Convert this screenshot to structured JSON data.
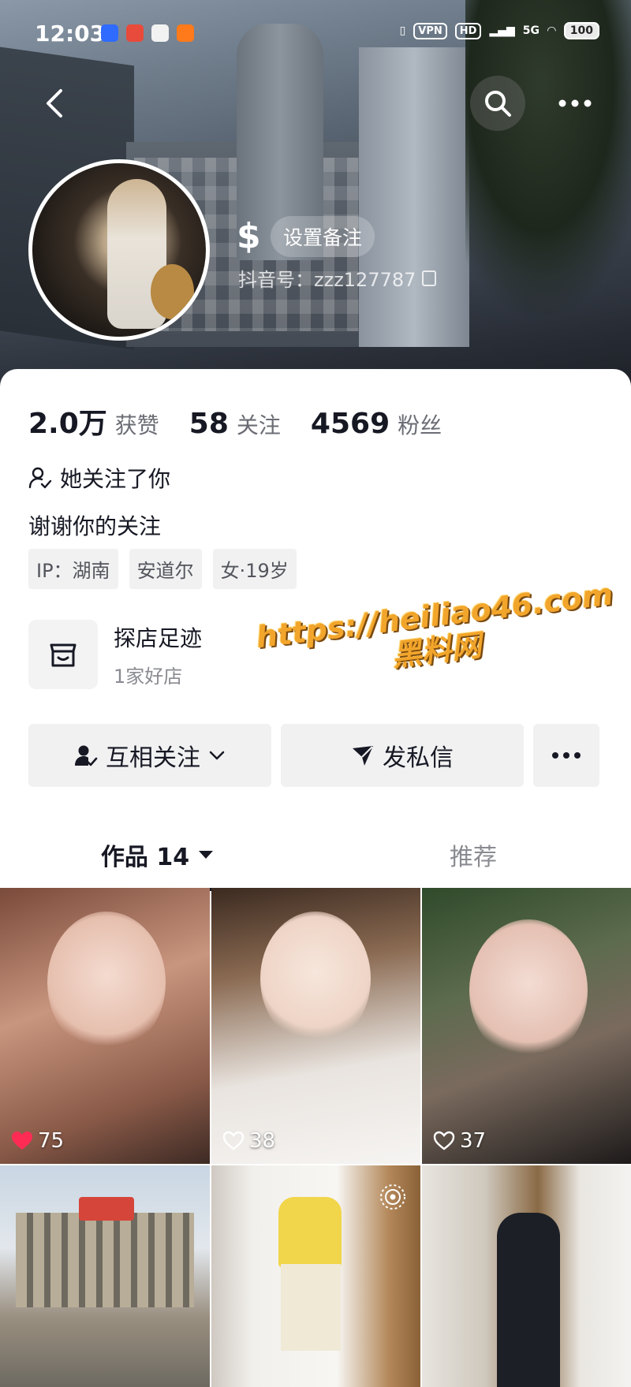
{
  "status_bar": {
    "time": "12:03",
    "vpn": "VPN",
    "hd": "HD",
    "net": "5G",
    "battery": "100"
  },
  "profile": {
    "remark_button": "设置备注",
    "id_label": "抖音号：zzz127787",
    "likes_count": "2.0万",
    "likes_label": "获赞",
    "following_count": "58",
    "following_label": "关注",
    "followers_count": "4569",
    "followers_label": "粉丝",
    "follows_you": "她关注了你",
    "bio": "谢谢你的关注",
    "tags": [
      "IP：湖南",
      "安道尔",
      "女·19岁"
    ]
  },
  "shop": {
    "title": "探店足迹",
    "subtitle": "1家好店"
  },
  "watermark": {
    "line1": "https://heiliao46.com",
    "line2": "黑料网"
  },
  "actions": {
    "follow": "互相关注",
    "message": "发私信"
  },
  "tabs": {
    "works": "作品 14",
    "recommend": "推荐"
  },
  "posts": [
    {
      "likes": "75",
      "liked": true
    },
    {
      "likes": "38",
      "liked": false
    },
    {
      "likes": "37",
      "liked": false
    },
    {
      "likes": "",
      "liked": false
    },
    {
      "likes": "",
      "liked": false
    },
    {
      "likes": "",
      "liked": false
    }
  ],
  "colors": {
    "liked_heart": "#fe2c55",
    "watermark": "#f2a52b",
    "text_primary": "#161823",
    "text_secondary": "#6b6d75"
  }
}
